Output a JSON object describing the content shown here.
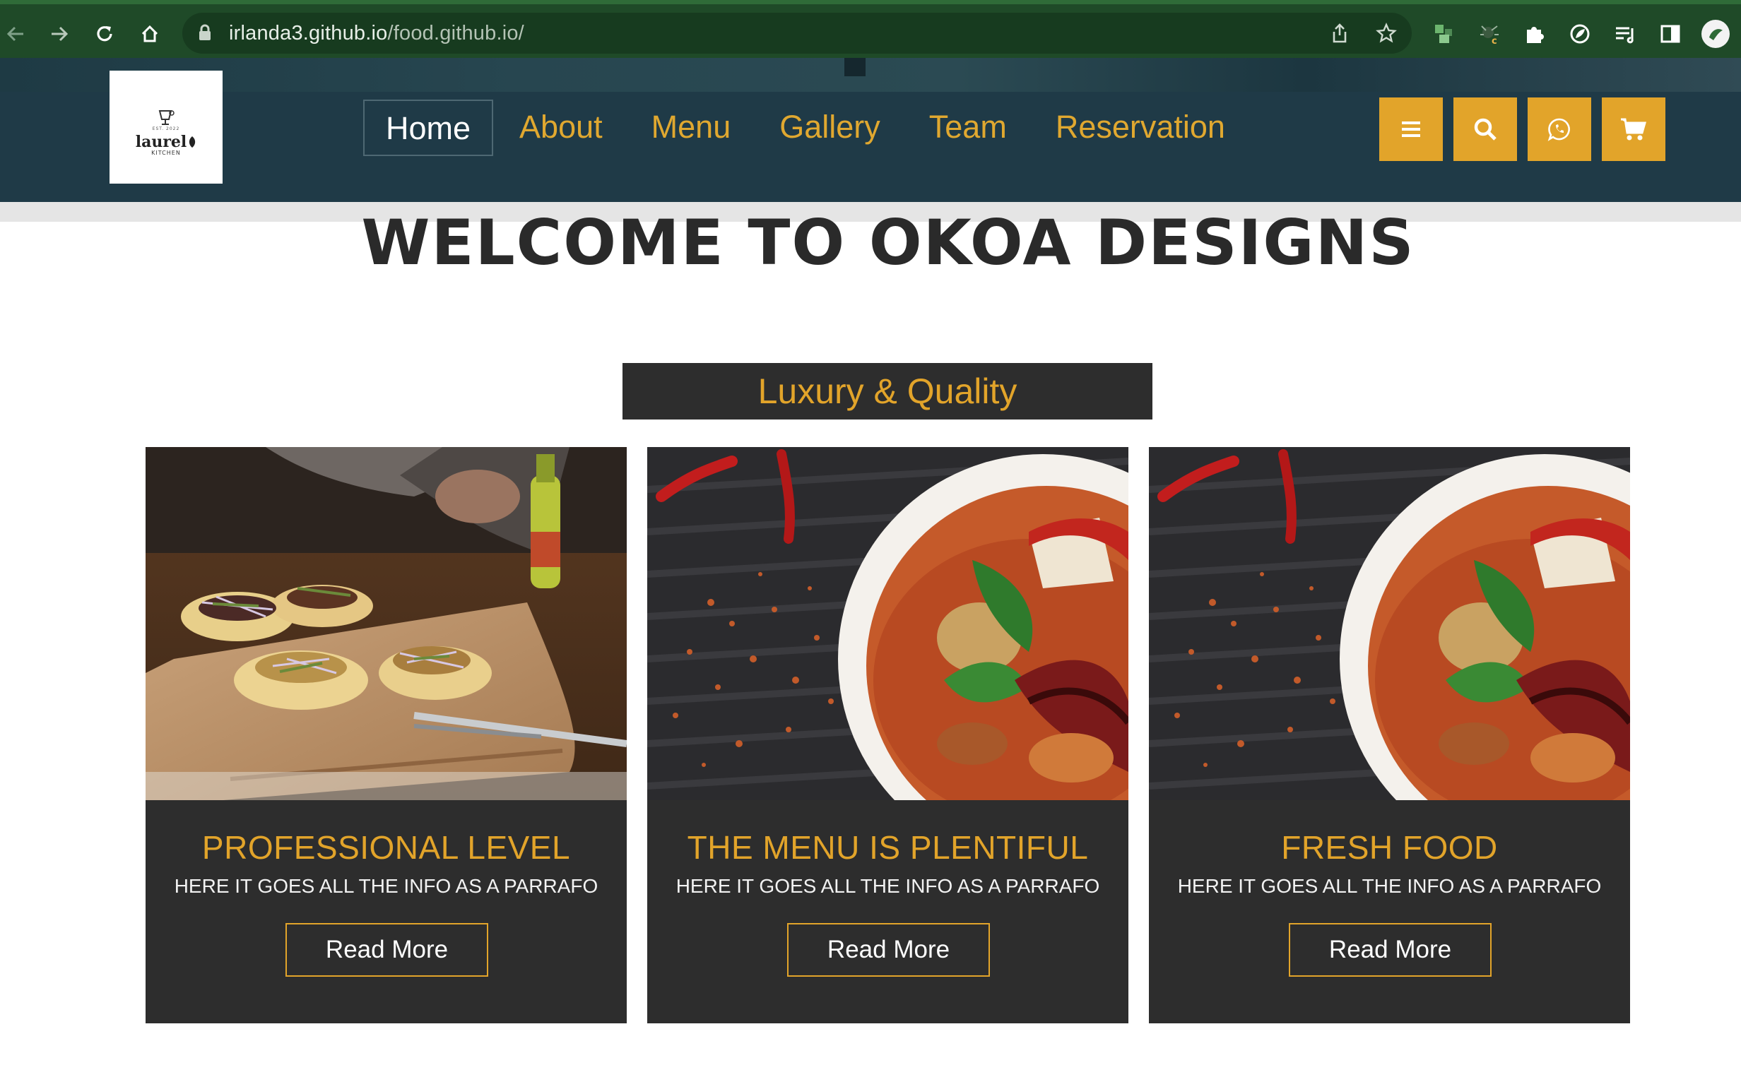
{
  "browser": {
    "url_host": "irlanda3.github.io",
    "url_path": "/food.github.io/",
    "icons": [
      "back-icon",
      "forward-icon",
      "reload-icon",
      "home-icon",
      "lock-icon",
      "share-icon",
      "bookmark-star-icon",
      "extension-green-icon",
      "extension-bug-icon",
      "puzzle-extensions-icon",
      "leaf-extension-icon",
      "reading-list-icon",
      "side-panel-icon",
      "profile-avatar-icon"
    ]
  },
  "header": {
    "logo": {
      "brand": "laurel",
      "est": "EST. 2022",
      "sub": "KITCHEN"
    },
    "nav": [
      {
        "label": "Home",
        "active": true
      },
      {
        "label": "About",
        "active": false
      },
      {
        "label": "Menu",
        "active": false
      },
      {
        "label": "Gallery",
        "active": false
      },
      {
        "label": "Team",
        "active": false
      },
      {
        "label": "Reservation",
        "active": false
      }
    ],
    "buttons": [
      "hamburger-menu-icon",
      "search-icon",
      "whatsapp-icon",
      "shopping-cart-icon"
    ]
  },
  "main": {
    "welcome": "WELCOME TO OKOA DESIGNS",
    "tagline": "Luxury & Quality",
    "cards": [
      {
        "title": "PROFESSIONAL LEVEL",
        "text": "HERE IT GOES ALL THE INFO AS A PARRAFO",
        "button": "Read More",
        "image": "tacos on wooden board"
      },
      {
        "title": "THE MENU IS PLENTIFUL",
        "text": "HERE IT GOES ALL THE INFO AS A PARRAFO",
        "button": "Read More",
        "image": "curry bowl with chilies"
      },
      {
        "title": "FRESH FOOD",
        "text": "HERE IT GOES ALL THE INFO AS A PARRAFO",
        "button": "Read More",
        "image": "curry bowl with chilies"
      }
    ]
  },
  "colors": {
    "header_bg": "#1f3a47",
    "accent_gold": "#e2a42a",
    "card_bg": "#2d2d2d",
    "browser_bg": "#1f4a28"
  }
}
